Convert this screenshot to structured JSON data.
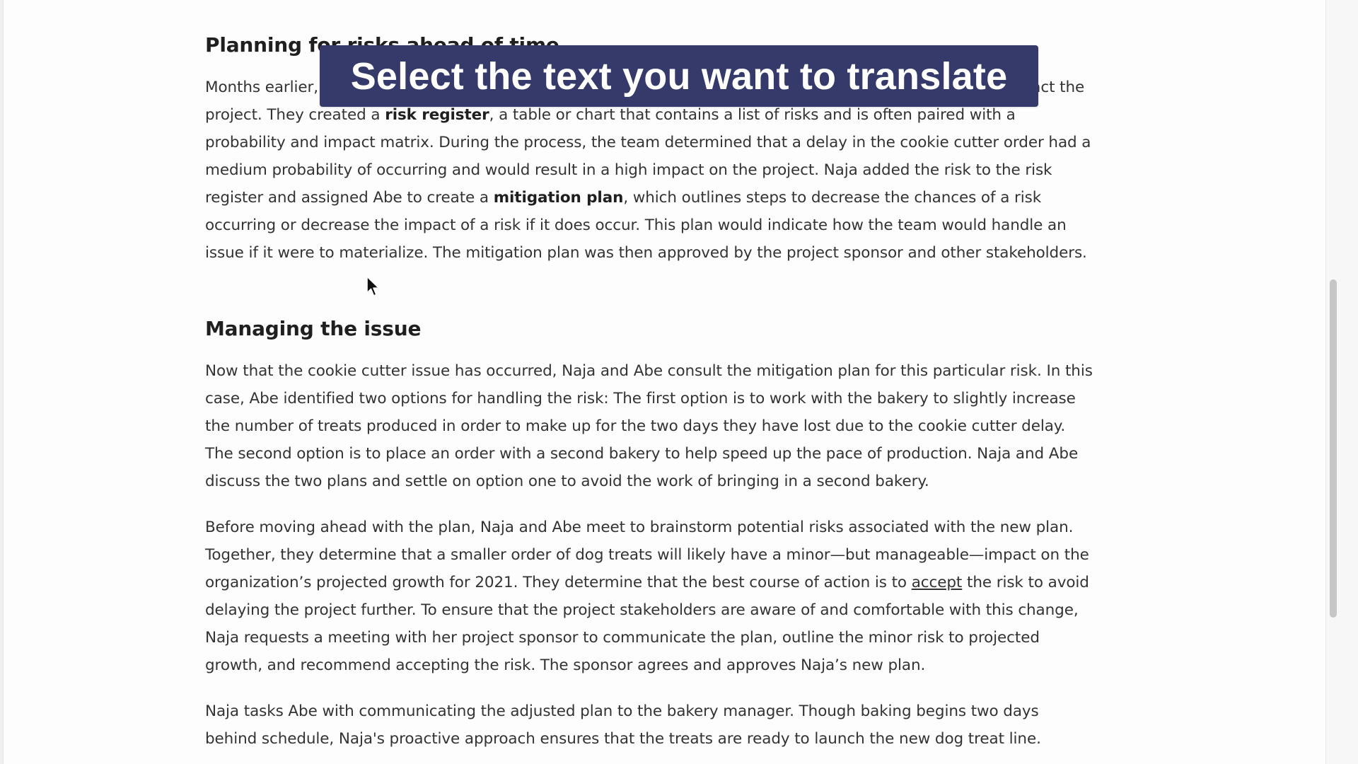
{
  "article": {
    "section1": {
      "heading": "Planning for risks ahead of time",
      "p1": {
        "t1": "Months earlier, Naja and the project team met to brainstorm and document the potential risks that could impact the project. They created a ",
        "b1": "risk register",
        "t2": ", a table or chart that contains a list of risks and is often paired with a probability and impact matrix. During the process, the team determined that a delay in the cookie cutter order had a medium probability of occurring and would result in a high impact on the project. Naja added the risk to the risk register and assigned Abe to create a ",
        "b2": "mitigation plan",
        "t3": ", which outlines steps to decrease the chances of a risk occurring or decrease the impact of a risk if it does occur. This plan would indicate how the team would handle an issue if it were to materialize. The mitigation plan was then approved by the project sponsor and other stakeholders."
      }
    },
    "section2": {
      "heading": "Managing the issue",
      "p1": "Now that the cookie cutter issue has occurred, Naja and Abe consult the mitigation plan for this particular risk. In this case, Abe identified two options for handling the risk: The first option is to work with the bakery to slightly increase the number of treats produced in order to make up for the two days they have lost due to the cookie cutter delay. The second option is to place an order with a second bakery to help speed up the pace of production. Naja and Abe discuss the two plans and settle on option one to avoid the work of bringing in a second bakery.",
      "p2": {
        "t1": "Before moving ahead with the plan, Naja and Abe meet to brainstorm potential risks associated with the new plan. Together, they determine that a smaller order of dog treats will likely have a minor—but manageable—impact on the organization’s projected growth for 2021. They determine that the best course of action is to ",
        "link": "accept",
        "t2": " the risk to avoid delaying the project further. To ensure that the project stakeholders are aware of and comfortable with this change, Naja requests a meeting with her project sponsor to communicate the plan, outline the minor risk to projected growth, and recommend accepting the risk. The sponsor agrees and approves Naja’s new plan."
      },
      "p3": "Naja tasks Abe with communicating the adjusted plan to the bakery manager. Though baking begins two days behind schedule, Naja's proactive approach ensures that the treats are ready to launch the new dog treat line."
    }
  },
  "overlay": {
    "banner_text": "Select the text you want to translate",
    "banner_color": "#353a6b"
  },
  "icons": {
    "cursor": "mouse-pointer-icon"
  }
}
